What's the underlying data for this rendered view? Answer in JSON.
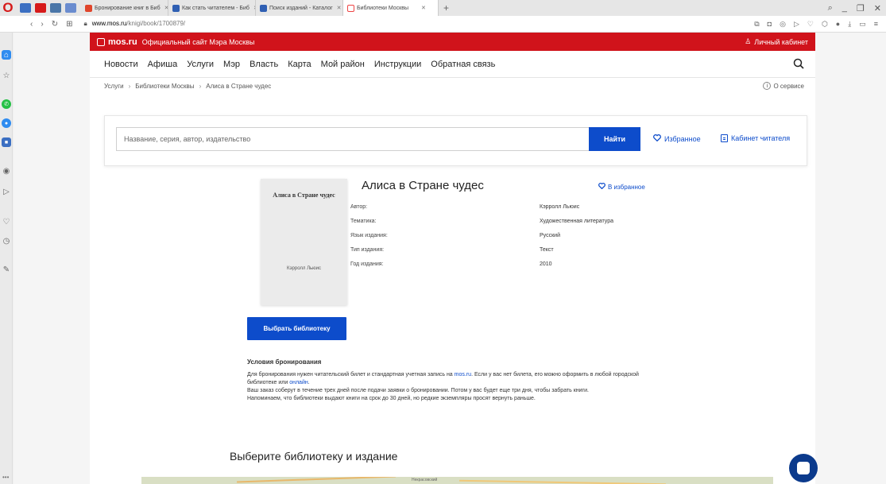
{
  "browser": {
    "tabs": [
      {
        "label": "Бронирование книг в Биб",
        "color": "#e0452b"
      },
      {
        "label": "Как стать читателем - Биб",
        "color": "#2f5fb3"
      },
      {
        "label": "Поиск изданий - Каталог",
        "color": "#2f5fb3"
      },
      {
        "label": "Библиотеки Москвы",
        "color": "#e44",
        "active": true
      }
    ],
    "url_host": "www.mos.ru",
    "url_path": "/knigi/book/1700879/"
  },
  "site": {
    "logo": "mos.ru",
    "tagline": "Официальный сайт Мэра Москвы",
    "account": "Личный кабинет",
    "brand_color": "#d0131b"
  },
  "nav": {
    "items": [
      "Новости",
      "Афиша",
      "Услуги",
      "Мэр",
      "Власть",
      "Карта",
      "Мой район",
      "Инструкции",
      "Обратная связь"
    ]
  },
  "breadcrumb": {
    "items": [
      "Услуги",
      "Библиотеки Москвы",
      "Алиса в Стране чудес"
    ],
    "about": "О сервисе"
  },
  "search": {
    "placeholder": "Название, серия, автор, издательство",
    "button": "Найти",
    "favorites": "Избранное",
    "cabinet": "Кабинет читателя",
    "accent": "#0d4ccb"
  },
  "book": {
    "cover_title": "Алиса в Стране чудес",
    "cover_author": "Кэрролл Льюис",
    "title": "Алиса в Стране чудес",
    "to_favorites": "В избранное",
    "details": [
      {
        "label": "Автор:",
        "value": "Кэрролл Льюис"
      },
      {
        "label": "Тематика:",
        "value": "Художественная литература"
      },
      {
        "label": "Язык издания:",
        "value": "Русский"
      },
      {
        "label": "Тип издания:",
        "value": "Текст"
      },
      {
        "label": "Год издания:",
        "value": "2010"
      }
    ],
    "choose_button": "Выбрать библиотеку"
  },
  "conditions": {
    "title": "Условия бронирования",
    "p1_before": "Для бронирования нужен читательский билет и стандартная учетная запись на ",
    "p1_link1": "mos.ru",
    "p1_middle": ". Если у вас нет билета, его можно оформить в любой городской библиотеке или ",
    "p1_link2": "онлайн",
    "p1_after": ".",
    "p2": "Ваш заказ соберут в течение трех дней после подачи заявки о бронировании. Потом у вас будет еще три дня, чтобы забрать книги.",
    "p3": "Напоминаем, что библиотеки выдают книги на срок до 30 дней, но редкие экземпляры просят вернуть раньше."
  },
  "section": {
    "choose_heading": "Выберите библиотеку и издание"
  },
  "map": {
    "place_label": "Некрасовский"
  }
}
